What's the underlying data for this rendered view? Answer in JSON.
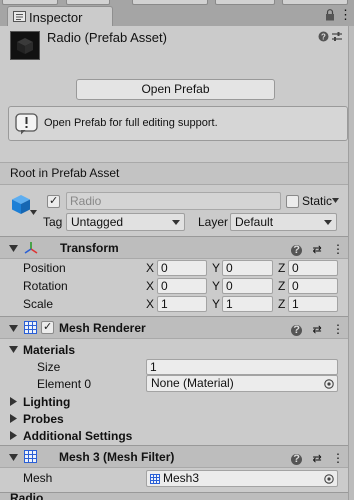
{
  "tab": {
    "label": "Inspector"
  },
  "header": {
    "title": "Radio (Prefab Asset)"
  },
  "open_prefab": {
    "button_label": "Open Prefab",
    "help_text": "Open Prefab for full editing support."
  },
  "root_label": "Root in Prefab Asset",
  "gameobject": {
    "name": "Radio",
    "active": true,
    "static_label": "Static",
    "tag_label": "Tag",
    "tag_value": "Untagged",
    "layer_label": "Layer",
    "layer_value": "Default"
  },
  "transform": {
    "title": "Transform",
    "rows": [
      {
        "label": "Position",
        "x": "0",
        "y": "0",
        "z": "0"
      },
      {
        "label": "Rotation",
        "x": "0",
        "y": "0",
        "z": "0"
      },
      {
        "label": "Scale",
        "x": "1",
        "y": "1",
        "z": "1"
      }
    ],
    "axes": [
      "X",
      "Y",
      "Z"
    ]
  },
  "mesh_renderer": {
    "title": "Mesh Renderer",
    "enabled": true,
    "materials_label": "Materials",
    "size_label": "Size",
    "size_value": "1",
    "element_label": "Element 0",
    "element_value": "None (Material)",
    "lighting_label": "Lighting",
    "probes_label": "Probes",
    "additional_label": "Additional Settings"
  },
  "mesh_filter": {
    "title": "Mesh 3 (Mesh Filter)",
    "mesh_label": "Mesh",
    "mesh_value": "Mesh3"
  },
  "next_component_partial": "Radio",
  "colors": {
    "panel_bg": "#cbcbcb",
    "header_bg": "#bdbdbd",
    "cube_blue": "#1c7fd6",
    "transform_icon_red": "#d33"
  }
}
